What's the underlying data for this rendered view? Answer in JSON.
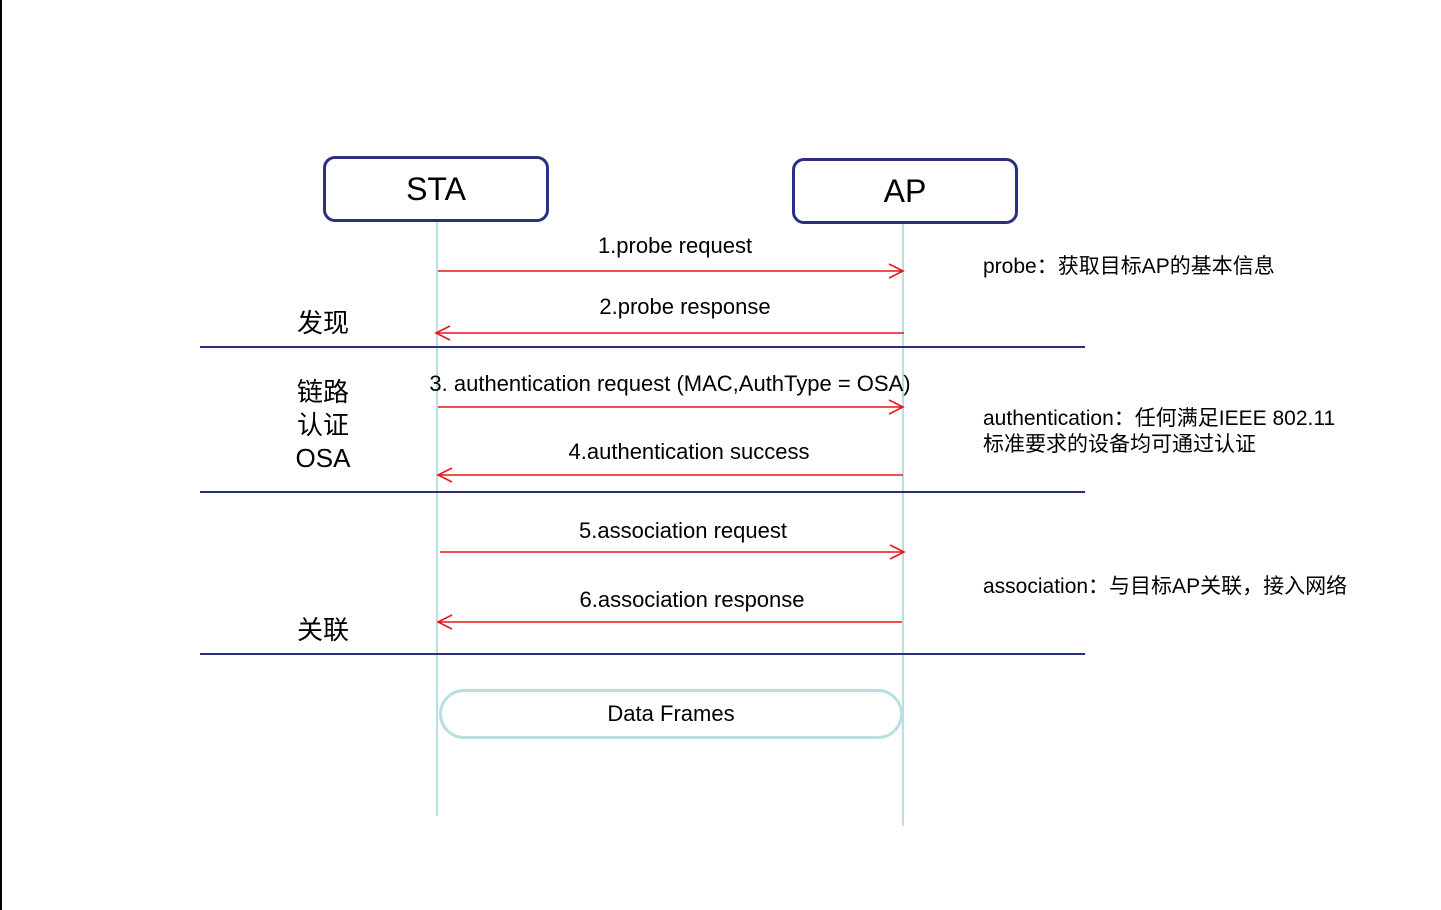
{
  "actors": {
    "sta": "STA",
    "ap": "AP"
  },
  "messages": [
    {
      "label": "1.probe request",
      "from": "STA",
      "to": "AP"
    },
    {
      "label": "2.probe response",
      "from": "AP",
      "to": "STA"
    },
    {
      "label": "3. authentication request (MAC,AuthType = OSA)",
      "from": "STA",
      "to": "AP"
    },
    {
      "label": "4.authentication success",
      "from": "AP",
      "to": "STA"
    },
    {
      "label": "5.association request",
      "from": "STA",
      "to": "AP"
    },
    {
      "label": "6.association response",
      "from": "AP",
      "to": "STA"
    }
  ],
  "phases": {
    "discovery": "发现",
    "link_auth_line1": "链路",
    "link_auth_line2": "认证",
    "link_auth_line3": "OSA",
    "association": "关联"
  },
  "notes": {
    "probe": "probe：获取目标AP的基本信息",
    "authentication_line1": "authentication：任何满足IEEE 802.11",
    "authentication_line2": "标准要求的设备均可通过认证",
    "association": "association：与目标AP关联，接入网络"
  },
  "data_frames": "Data Frames",
  "colors": {
    "arrow": "#e8161b",
    "actor_border": "#2b2f7f",
    "lifeline": "#b9dfe3",
    "separator": "#2b2f7f"
  }
}
